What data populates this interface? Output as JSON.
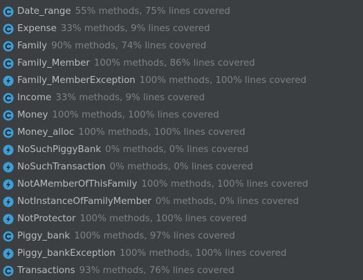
{
  "colors": {
    "background": "#3c3f41",
    "class_name_text": "#bbbbbb",
    "stats_text": "#808080",
    "icon_circle": "#3c9fd8",
    "icon_glyph": "#2b2b2b"
  },
  "coverage": {
    "items": [
      {
        "name": "Date_range",
        "stats": "55% methods, 75% lines covered",
        "icon": "class-icon"
      },
      {
        "name": "Expense",
        "stats": "33% methods, 9% lines covered",
        "icon": "class-icon"
      },
      {
        "name": "Family",
        "stats": "90% methods, 74% lines covered",
        "icon": "class-icon"
      },
      {
        "name": "Family_Member",
        "stats": "100% methods, 86% lines covered",
        "icon": "class-icon"
      },
      {
        "name": "Family_MemberException",
        "stats": "100% methods, 100% lines covered",
        "icon": "exception-icon"
      },
      {
        "name": "Income",
        "stats": "33% methods, 9% lines covered",
        "icon": "class-icon"
      },
      {
        "name": "Money",
        "stats": "100% methods, 100% lines covered",
        "icon": "class-icon"
      },
      {
        "name": "Money_alloc",
        "stats": "100% methods, 100% lines covered",
        "icon": "class-icon"
      },
      {
        "name": "NoSuchPiggyBank",
        "stats": "0% methods, 0% lines covered",
        "icon": "exception-icon"
      },
      {
        "name": "NoSuchTransaction",
        "stats": "0% methods, 0% lines covered",
        "icon": "exception-icon"
      },
      {
        "name": "NotAMemberOfThisFamily",
        "stats": "100% methods, 100% lines covered",
        "icon": "exception-icon"
      },
      {
        "name": "NotInstanceOfFamilyMember",
        "stats": "0% methods, 0% lines covered",
        "icon": "exception-icon"
      },
      {
        "name": "NotProtector",
        "stats": "100% methods, 100% lines covered",
        "icon": "exception-icon"
      },
      {
        "name": "Piggy_bank",
        "stats": "100% methods, 97% lines covered",
        "icon": "class-icon"
      },
      {
        "name": "Piggy_bankException",
        "stats": "100% methods, 100% lines covered",
        "icon": "exception-icon"
      },
      {
        "name": "Transactions",
        "stats": "93% methods, 76% lines covered",
        "icon": "class-icon"
      }
    ]
  }
}
